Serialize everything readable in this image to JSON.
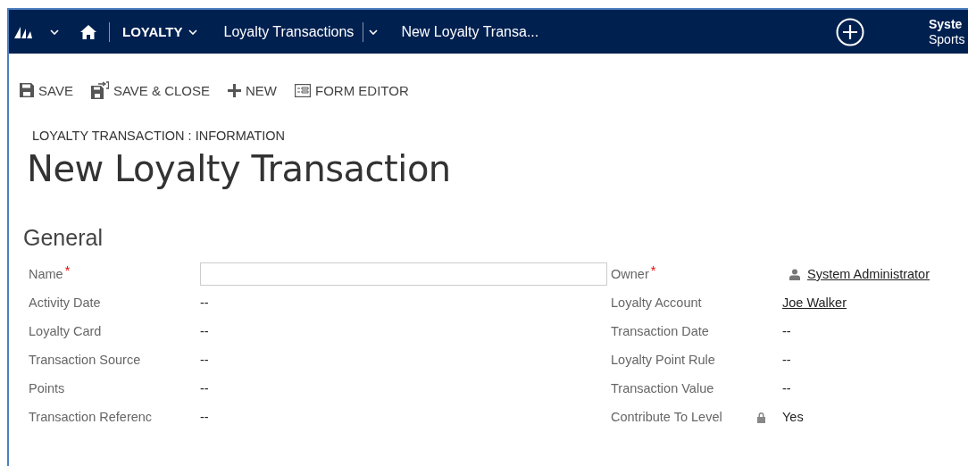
{
  "nav": {
    "area": "LOYALTY",
    "entity": "Loyalty Transactions",
    "record": "New Loyalty Transa...",
    "user": "Syste",
    "org": "Sports"
  },
  "toolbar": [
    {
      "label": "SAVE",
      "kind": "save"
    },
    {
      "label": "SAVE & CLOSE",
      "kind": "save-close"
    },
    {
      "label": "NEW",
      "kind": "new"
    },
    {
      "label": "FORM EDITOR",
      "kind": "form-editor"
    }
  ],
  "form": {
    "breadcrumb": "LOYALTY TRANSACTION : INFORMATION",
    "title": "New Loyalty Transaction"
  },
  "section": {
    "title": "General",
    "left_fields": [
      {
        "label": "Name",
        "required_mark": "*",
        "kind": "input",
        "locked": false
      },
      {
        "label": "Activity Date",
        "kind": "text",
        "value": "--",
        "locked": false
      },
      {
        "label": "Loyalty Card",
        "kind": "text",
        "value": "--",
        "locked": false
      },
      {
        "label": "Transaction Source",
        "kind": "text",
        "value": "--",
        "locked": false
      },
      {
        "label": "Points",
        "kind": "text",
        "value": "--",
        "locked": false
      },
      {
        "label": "Transaction Referenc",
        "kind": "text",
        "value": "--",
        "locked": false
      }
    ],
    "right_fields": [
      {
        "label": "Owner",
        "required_mark": "*",
        "kind": "user-link",
        "value": "System Administrator",
        "locked": false
      },
      {
        "label": "Loyalty Account",
        "kind": "link",
        "value": "Joe Walker",
        "locked": false
      },
      {
        "label": "Transaction Date",
        "kind": "text",
        "value": "--",
        "locked": false
      },
      {
        "label": "Loyalty Point Rule",
        "kind": "text",
        "value": "--",
        "locked": false
      },
      {
        "label": "Transaction Value",
        "kind": "text",
        "value": "--",
        "locked": false
      },
      {
        "label": "Contribute To Level",
        "kind": "text",
        "value": "Yes",
        "locked": true
      }
    ]
  }
}
